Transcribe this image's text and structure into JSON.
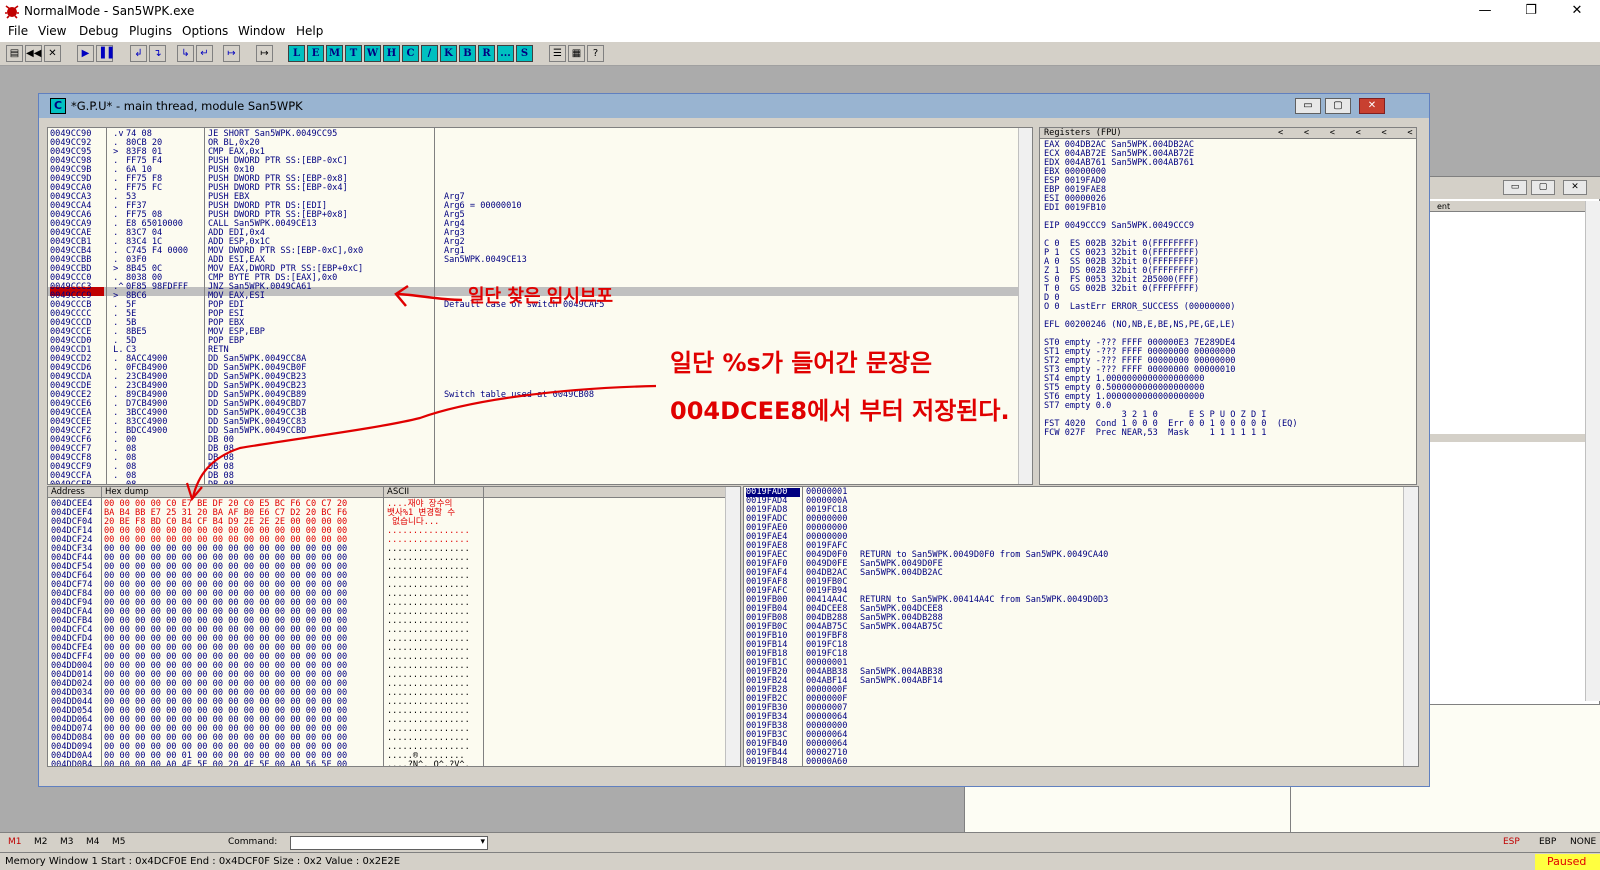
{
  "window": {
    "title": "NormalMode - San5WPK.exe",
    "min_glyph": "—",
    "restore_glyph": "❐",
    "close_glyph": "✕"
  },
  "menu": [
    "File",
    "View",
    "Debug",
    "Plugins",
    "Options",
    "Window",
    "Help"
  ],
  "toolbar": {
    "buttons": [
      "▤",
      "◀◀",
      "✕",
      "▶",
      "▐▐",
      "↲",
      "↴",
      "↳",
      "↵",
      "↦"
    ],
    "letters": [
      "L",
      "E",
      "M",
      "T",
      "W",
      "H",
      "C",
      "/",
      "K",
      "B",
      "R",
      "...",
      "S"
    ],
    "extra": [
      "☰",
      "▦",
      "?"
    ]
  },
  "cpu_window": {
    "icon_label": "C",
    "title": "*G.P.U* - main thread, module San5WPK",
    "min": "▭",
    "max": "▢",
    "close": "✕"
  },
  "back_window": {
    "header_text": "ent",
    "min": "▭",
    "max": "▢",
    "close": "✕"
  },
  "disasm": {
    "addresses": "0049CC90\n0049CC92\n0049CC95\n0049CC98\n0049CC9B\n0049CC9D\n0049CCA0\n0049CCA3\n0049CCA4\n0049CCA6\n0049CCA9\n0049CCAE\n0049CCB1\n0049CCB4\n0049CCBB\n0049CCBD\n0049CCC0\n0049CCC3\n0049CCC9\n0049CCCB\n0049CCCC\n0049CCCD\n0049CCCE\n0049CCD0\n0049CCD1\n0049CCD2\n0049CCD6\n0049CCDA\n0049CCDE\n0049CCE2\n0049CCE6\n0049CCEA\n0049CCEE\n0049CCF2\n0049CCF6\n0049CCF7\n0049CCF8\n0049CCF9\n0049CCFA\n0049CCFB",
    "markers": " .v\n .\n >\n .\n .\n .\n .\n .\n .\n .\n .\n .\n .\n .\n .\n >\n .\n .^\n >\n .\n .\n .\n .\n .\n L.\n .\n .\n .\n .\n .\n .\n .\n .\n .\n .\n .\n .\n .\n .\n .",
    "bytes": "74 08\n80CB 20\n83F8 01\nFF75 F4\n6A 10\nFF75 F8\nFF75 FC\n53\nFF37\nFF75 08\nE8 65010000\n83C7 04\n83C4 1C\nC745 F4 0000\n03F0\n8B45 0C\n8038 00\n0F85 98FDFFF\n8BC6\n5F\n5E\n5B\n8BE5\n5D\nC3\n8ACC4900\n0FCB4900\n23CB4900\n23CB4900\n89CB4900\nD7CB4900\n3BCC4900\n83CC4900\nBDCC4900\n00\n08\n08\n08\n08\n08",
    "instructions": "JE SHORT San5WPK.0049CC95\nOR BL,0x20\nCMP EAX,0x1\nPUSH DWORD PTR SS:[EBP-0xC]\nPUSH 0x10\nPUSH DWORD PTR SS:[EBP-0x8]\nPUSH DWORD PTR SS:[EBP-0x4]\nPUSH EBX\nPUSH DWORD PTR DS:[EDI]\nPUSH DWORD PTR SS:[EBP+0x8]\nCALL San5WPK.0049CE13\nADD EDI,0x4\nADD ESP,0x1C\nMOV DWORD PTR SS:[EBP-0xC],0x0\nADD ESI,EAX\nMOV EAX,DWORD PTR SS:[EBP+0xC]\nCMP BYTE PTR DS:[EAX],0x0\nJNZ San5WPK.0049CA61\nMOV EAX,ESI\nPOP EDI\nPOP ESI\nPOP EBX\nMOV ESP,EBP\nPOP EBP\nRETN\nDD San5WPK.0049CC8A\nDD San5WPK.0049CB0F\nDD San5WPK.0049CB23\nDD San5WPK.0049CB23\nDD San5WPK.0049CB89\nDD San5WPK.0049CBD7\nDD San5WPK.0049CC3B\nDD San5WPK.0049CC83\nDD San5WPK.0049CCBD\nDB 00\nDB 08\nDB 08\nDB 08\nDB 08\nDB 08",
    "comments": "\n\n\n\n\n\n\nArg7\nArg6 = 00000010\nArg5\nArg4\nArg3\nArg2\nArg1\nSan5WPK.0049CE13\n\n\n\n\nDefault case of switch 0049CAF5\n\n\n\n\n\n\n\n\n\nSwitch table used at 0049CB08\n\n\n\n\n\n\n\n\n\n\n\n\n\n\n\nIndex table to switch 0049CCD2",
    "selected_addr": "0049CCC9"
  },
  "registers": {
    "header": "Registers (FPU)",
    "header_arrows": "<    <    <    <    <    <",
    "text": "EAX 004DB2AC San5WPK.004DB2AC\nECX 004AB72E San5WPK.004AB72E\nEDX 004AB761 San5WPK.004AB761\nEBX 00000000\nESP 0019FAD0\nEBP 0019FAE8\nESI 00000026\nEDI 0019FB10\n\nEIP 0049CCC9 San5WPK.0049CCC9\n\nC 0  ES 002B 32bit 0(FFFFFFFF)\nP 1  CS 0023 32bit 0(FFFFFFFF)\nA 0  SS 002B 32bit 0(FFFFFFFF)\nZ 1  DS 002B 32bit 0(FFFFFFFF)\nS 0  FS 0053 32bit 2B5000(FFF)\nT 0  GS 002B 32bit 0(FFFFFFFF)\nD 0\nO 0  LastErr ERROR_SUCCESS (00000000)\n\nEFL 00200246 (NO,NB,E,BE,NS,PE,GE,LE)\n\nST0 empty -??? FFFF 000000E3 7E289DE4\nST1 empty -??? FFFF 00000000 00000000\nST2 empty -??? FFFF 00000000 00000000\nST3 empty -??? FFFF 00000000 00000010\nST4 empty 1.0000000000000000000\nST5 empty 0.5000000000000000000\nST6 empty 1.0000000000000000000\nST7 empty 0.0\n               3 2 1 0      E S P U O Z D I\nFST 4020  Cond 1 0 0 0  Err 0 0 1 0 0 0 0 0  (EQ)\nFCW 027F  Prec NEAR,53  Mask    1 1 1 1 1 1"
  },
  "dump": {
    "col_address": "Address",
    "col_hex": "Hex dump",
    "col_ascii": "ASCII",
    "addresses": "004DCEE4\n004DCEF4\n004DCF04\n004DCF14\n004DCF24\n004DCF34\n004DCF44\n004DCF54\n004DCF64\n004DCF74\n004DCF84\n004DCF94\n004DCFA4\n004DCFB4\n004DCFC4\n004DCFD4\n004DCFE4\n004DCFF4\n004DD004\n004DD014\n004DD024\n004DD034\n004DD044\n004DD054\n004DD064\n004DD074\n004DD084\n004DD094\n004DD0A4\n004DD0B4",
    "hex_rows": [
      "00 00 00 00 C0 E7 BE DF 20 C0 E5 BC F6 C0 C7 20",
      "BA B4 BB E7 25 31 20 BA AF B0 E6 C7 D2 20 BC F6",
      "20 BE F8 BD C0 B4 CF B4 D9 2E 2E 2E 00 00 00 00",
      "00 00 00 00 00 00 00 00 00 00 00 00 00 00 00 00",
      "00 00 00 00 00 00 00 00 00 00 00 00 00 00 00 00",
      "00 00 00 00 00 00 00 00 00 00 00 00 00 00 00 00",
      "00 00 00 00 00 00 00 00 00 00 00 00 00 00 00 00",
      "00 00 00 00 00 00 00 00 00 00 00 00 00 00 00 00",
      "00 00 00 00 00 00 00 00 00 00 00 00 00 00 00 00",
      "00 00 00 00 00 00 00 00 00 00 00 00 00 00 00 00",
      "00 00 00 00 00 00 00 00 00 00 00 00 00 00 00 00",
      "00 00 00 00 00 00 00 00 00 00 00 00 00 00 00 00",
      "00 00 00 00 00 00 00 00 00 00 00 00 00 00 00 00",
      "00 00 00 00 00 00 00 00 00 00 00 00 00 00 00 00",
      "00 00 00 00 00 00 00 00 00 00 00 00 00 00 00 00",
      "00 00 00 00 00 00 00 00 00 00 00 00 00 00 00 00",
      "00 00 00 00 00 00 00 00 00 00 00 00 00 00 00 00",
      "00 00 00 00 00 00 00 00 00 00 00 00 00 00 00 00",
      "00 00 00 00 00 00 00 00 00 00 00 00 00 00 00 00",
      "00 00 00 00 00 00 00 00 00 00 00 00 00 00 00 00",
      "00 00 00 00 00 00 00 00 00 00 00 00 00 00 00 00",
      "00 00 00 00 00 00 00 00 00 00 00 00 00 00 00 00",
      "00 00 00 00 00 00 00 00 00 00 00 00 00 00 00 00",
      "00 00 00 00 00 00 00 00 00 00 00 00 00 00 00 00",
      "00 00 00 00 00 00 00 00 00 00 00 00 00 00 00 00",
      "00 00 00 00 00 00 00 00 00 00 00 00 00 00 00 00",
      "00 00 00 00 00 00 00 00 00 00 00 00 00 00 00 00",
      "00 00 00 00 00 00 00 00 00 00 00 00 00 00 00 00",
      "00 00 00 00 00 01 00 00 00 00 00 00 00 00 00 00",
      "00 00 00 00 A0 4E 5E 00 20 4F 5E 00 A0 56 5E 00"
    ],
    "ascii_rows": [
      "....재야 장수의 ",
      "뱃사%1 변경할 수",
      " 없습니다...",
      "................",
      "................",
      "................",
      "................",
      "................",
      "................",
      "................",
      "................",
      "................",
      "................",
      "................",
      "................",
      "................",
      "................",
      "................",
      "................",
      "................",
      "................",
      "................",
      "................",
      "................",
      "................",
      "................",
      "................",
      "................",
      ".....®.........",
      "....?N^. O^.?V^."
    ]
  },
  "stack": {
    "first_addr": "0019FAD0",
    "addresses": "\n0019FAD4\n0019FAD8\n0019FADC\n0019FAE0\n0019FAE4\n0019FAE8\n0019FAEC\n0019FAF0\n0019FAF4\n0019FAF8\n0019FAFC\n0019FB00\n0019FB04\n0019FB08\n0019FB0C\n0019FB10\n0019FB14\n0019FB18\n0019FB1C\n0019FB20\n0019FB24\n0019FB28\n0019FB2C\n0019FB30\n0019FB34\n0019FB38\n0019FB3C\n0019FB40\n0019FB44\n0019FB48\n0019FB4C",
    "values": "00000001\n0000000A\n0019FC18\n00000000\n00000000\n00000000\n0019FAFC\n0049D0F0\n0049D0FE\n004DB2AC\n0019FB0C\n0019FB94\n00414A4C\n004DCEE8\n004DB288\n004AB75C\n0019FBF8\n0019FC18\n0019FC18\n00000001\n004ABB38\n004ABF14\n0000000F\n0000000F\n00000007\n00000064\n00000000\n00000064\n00000064\n00002710\n00000A60",
    "comments": "\n\n\n\n\n\n\nRETURN to San5WPK.0049D0F0 from San5WPK.0049CA40\nSan5WPK.0049D0FE\nSan5WPK.004DB2AC\n\n\nRETURN to San5WPK.00414A4C from San5WPK.0049D0D3\nSan5WPK.004DCEE8\nSan5WPK.004DB288\nSan5WPK.004AB75C\n\n\n\n\nSan5WPK.004ABB38\nSan5WPK.004ABF14"
  },
  "annotations": {
    "note1": "일단 찾은 임시브포",
    "note2": "일단 %s가 들어간 문장은 004DCEE8에서 부터 저장된다."
  },
  "cmdbar": {
    "marks": [
      "M1",
      "M2",
      "M3",
      "M4",
      "M5"
    ],
    "label": "Command:",
    "dropdown": "▾",
    "regs": [
      "ESP",
      "EBP",
      "NONE"
    ]
  },
  "status": {
    "text": "Memory Window 1  Start : 0x4DCF0E  End : 0x4DCF0F  Size : 0x2 Value : 0x2E2E",
    "state": "Paused"
  }
}
